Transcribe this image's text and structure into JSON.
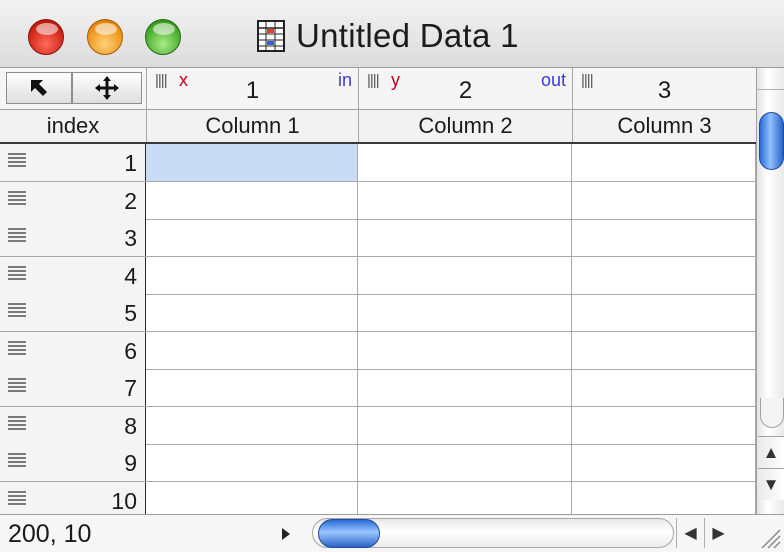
{
  "window": {
    "title": "Untitled Data 1"
  },
  "toolbar": {
    "arrow_tool_icon": "arrow-up-left-icon",
    "move_tool_icon": "move-arrows-icon"
  },
  "columns": [
    {
      "number": "1",
      "title": "Column 1",
      "role_left": "x",
      "role_right": "in"
    },
    {
      "number": "2",
      "title": "Column 2",
      "role_left": "y",
      "role_right": "out"
    },
    {
      "number": "3",
      "title": "Column 3",
      "role_left": "",
      "role_right": ""
    }
  ],
  "index_header": "index",
  "rows": [
    "1",
    "2",
    "3",
    "4",
    "5",
    "6",
    "7",
    "8",
    "9",
    "10"
  ],
  "selection": {
    "row": "1",
    "column": "Column 1"
  },
  "status": {
    "coordinates": "200, 10"
  },
  "colors": {
    "selected_cell": "#c9dcf6",
    "role_x": "#c4001e",
    "role_in": "#3a3ae0",
    "scroll_thumb": "#3d7fe6"
  }
}
